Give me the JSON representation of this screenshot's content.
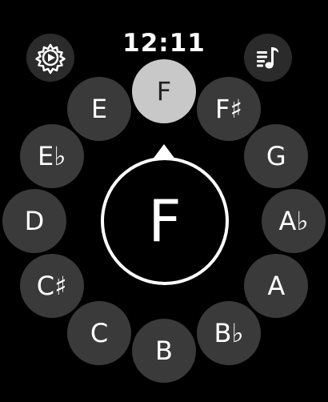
{
  "status": {
    "time": "12:11"
  },
  "buttons": {
    "settings_icon": "gear-play-icon",
    "playlist_icon": "music-list-icon"
  },
  "notes": [
    {
      "label": "F",
      "selected": true
    },
    {
      "label": "F♯",
      "selected": false
    },
    {
      "label": "G",
      "selected": false
    },
    {
      "label": "A♭",
      "selected": false
    },
    {
      "label": "A",
      "selected": false
    },
    {
      "label": "B♭",
      "selected": false
    },
    {
      "label": "B",
      "selected": false
    },
    {
      "label": "C",
      "selected": false
    },
    {
      "label": "C♯",
      "selected": false
    },
    {
      "label": "D",
      "selected": false
    },
    {
      "label": "E♭",
      "selected": false
    },
    {
      "label": "E",
      "selected": false
    }
  ],
  "center": {
    "label": "F"
  },
  "colors": {
    "background": "#000000",
    "note_bg": "#3a3a3a",
    "selected_bg": "#c8c8c8"
  }
}
